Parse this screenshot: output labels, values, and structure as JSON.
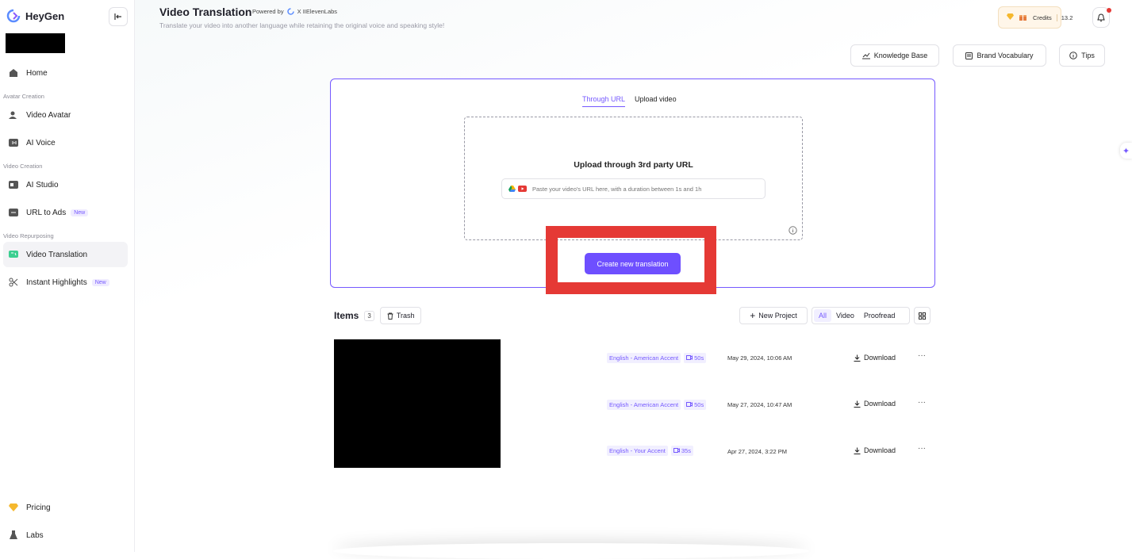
{
  "app": {
    "name": "HeyGen"
  },
  "sidebar": {
    "home": "Home",
    "sections": {
      "avatar": "Avatar Creation",
      "video": "Video Creation",
      "repurposing": "Video Repurposing"
    },
    "items": {
      "video_avatar": "Video Avatar",
      "ai_voice": "AI Voice",
      "ai_studio": "AI Studio",
      "url_to_ads": "URL to Ads",
      "video_translation": "Video Translation",
      "instant_highlights": "Instant Highlights"
    },
    "new_badge": "New",
    "pricing": "Pricing",
    "labs": "Labs"
  },
  "header": {
    "title": "Video Translation",
    "powered_by": "Powered by",
    "partner": "X IIElevenLabs",
    "subtitle": "Translate your video into another language while retaining the original voice and speaking style!",
    "credits_label": "Credits",
    "credits_value": "13.2",
    "knowledge_base": "Knowledge Base",
    "brand_vocabulary": "Brand Vocabulary",
    "tips": "Tips"
  },
  "upload": {
    "tab_url": "Through URL",
    "tab_upload": "Upload video",
    "title": "Upload through 3rd party URL",
    "placeholder": "Paste your video's URL here, with a duration between 1s and 1h",
    "create_button": "Create new translation"
  },
  "items": {
    "title": "Items",
    "count": "3",
    "trash": "Trash",
    "new_project": "New Project",
    "filters": [
      "All",
      "Video",
      "Proofread"
    ],
    "active_filter": "All",
    "rows": [
      {
        "language": "English - American Accent",
        "duration": "50s",
        "date": "May 29, 2024, 10:06 AM",
        "download": "Download"
      },
      {
        "language": "English - American Accent",
        "duration": "50s",
        "date": "May 27, 2024, 10:47 AM",
        "download": "Download"
      },
      {
        "language": "English - Your Accent",
        "duration": "35s",
        "date": "Apr 27, 2024, 3:22 PM",
        "download": "Download"
      }
    ]
  },
  "colors": {
    "accent": "#7559ff",
    "button": "#6e4fff",
    "highlight": "#e53935"
  }
}
